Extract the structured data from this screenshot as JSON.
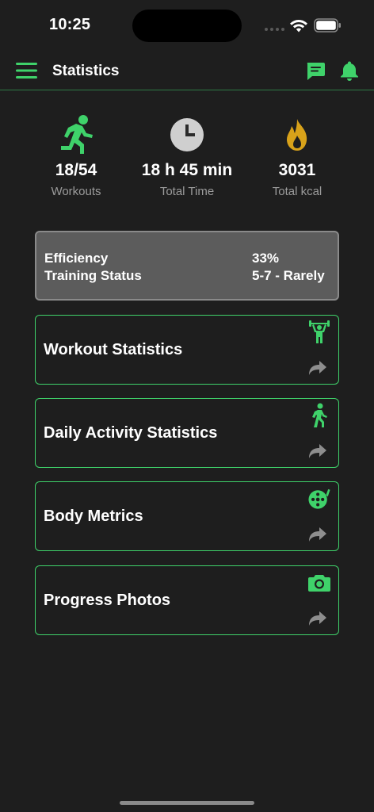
{
  "status_bar": {
    "time": "10:25"
  },
  "header": {
    "title": "Statistics"
  },
  "stats": [
    {
      "value": "18/54",
      "label": "Workouts",
      "icon": "running-icon"
    },
    {
      "value": "18 h 45 min",
      "label": "Total Time",
      "icon": "clock-icon"
    },
    {
      "value": "3031",
      "label": "Total kcal",
      "icon": "flame-icon"
    }
  ],
  "efficiency": {
    "efficiency_label": "Efficiency",
    "efficiency_value": "33%",
    "training_label": "Training Status",
    "training_value": "5-7 - Rarely"
  },
  "cards": [
    {
      "title": "Workout Statistics",
      "icon": "weightlifter-icon"
    },
    {
      "title": "Daily Activity Statistics",
      "icon": "walking-icon"
    },
    {
      "title": "Body Metrics",
      "icon": "measuring-tape-icon"
    },
    {
      "title": "Progress Photos",
      "icon": "camera-icon"
    }
  ],
  "colors": {
    "accent": "#3fd26a",
    "background": "#1e1e1e",
    "card_gray": "#5c5c5c",
    "flame": "#d8a21a",
    "muted_text": "#9b9b9b"
  }
}
